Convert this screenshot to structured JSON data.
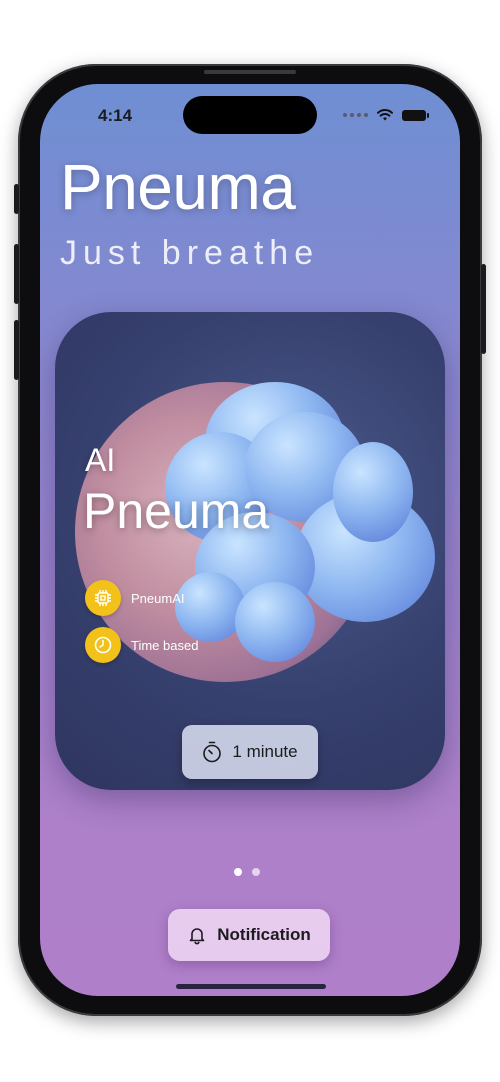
{
  "status_bar": {
    "time": "4:14",
    "wifi_icon": "wifi-icon",
    "battery_icon": "battery-icon"
  },
  "header": {
    "title": "Pneuma",
    "subtitle": "Just breathe"
  },
  "card": {
    "eyebrow": "AI",
    "title": "Pneuma",
    "tags": [
      {
        "icon": "chip-icon",
        "label": "PneumAI"
      },
      {
        "icon": "clock-icon",
        "label": "Time based"
      }
    ],
    "duration_button": {
      "icon": "timer-icon",
      "label": "1 minute"
    }
  },
  "pager": {
    "pages": 2,
    "current": 1
  },
  "notification_button": {
    "icon": "bell-icon",
    "label": "Notification"
  },
  "colors": {
    "accent_yellow": "#f3c21a",
    "page_dot_active": "#ffffff",
    "page_dot_inactive": "#e6d3f0"
  }
}
